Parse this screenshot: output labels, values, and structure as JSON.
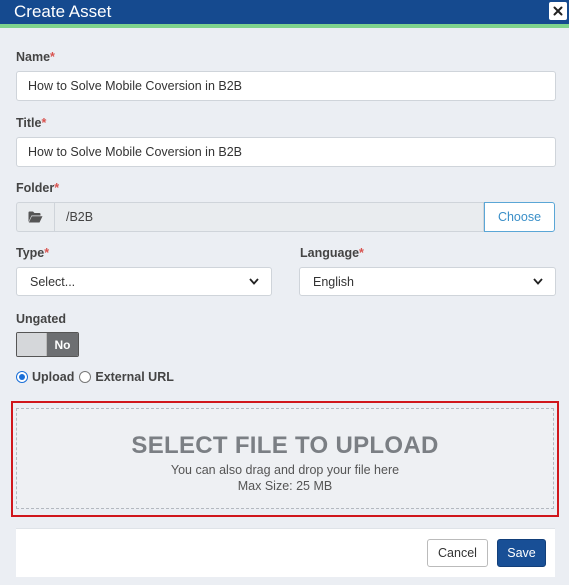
{
  "dialog": {
    "title": "Create Asset",
    "close_symbol": "×"
  },
  "required_marker": "*",
  "fields": {
    "name": {
      "label": "Name",
      "value": "How to Solve Mobile Coversion in B2B"
    },
    "title": {
      "label": "Title",
      "value": "How to Solve Mobile Coversion in B2B"
    },
    "folder": {
      "label": "Folder",
      "path": "/B2B",
      "choose_label": "Choose",
      "icon": "folder-open-icon"
    },
    "type": {
      "label": "Type",
      "selected": "Select..."
    },
    "language": {
      "label": "Language",
      "selected": "English"
    },
    "ungated": {
      "label": "Ungated",
      "state": "No"
    }
  },
  "source": {
    "options": [
      {
        "label": "Upload",
        "checked": true
      },
      {
        "label": "External URL",
        "checked": false
      }
    ]
  },
  "upload": {
    "title": "SELECT FILE TO UPLOAD",
    "subtitle": "You can also drag and drop your file here",
    "max_size": "Max Size: 25 MB"
  },
  "footer": {
    "cancel_label": "Cancel",
    "save_label": "Save"
  },
  "colors": {
    "header": "#154a8f",
    "header_accent": "#7ed38c",
    "required": "#d9534f",
    "highlight_border": "#d0161b",
    "primary_button": "#184f96",
    "link": "#3a8fc8"
  }
}
